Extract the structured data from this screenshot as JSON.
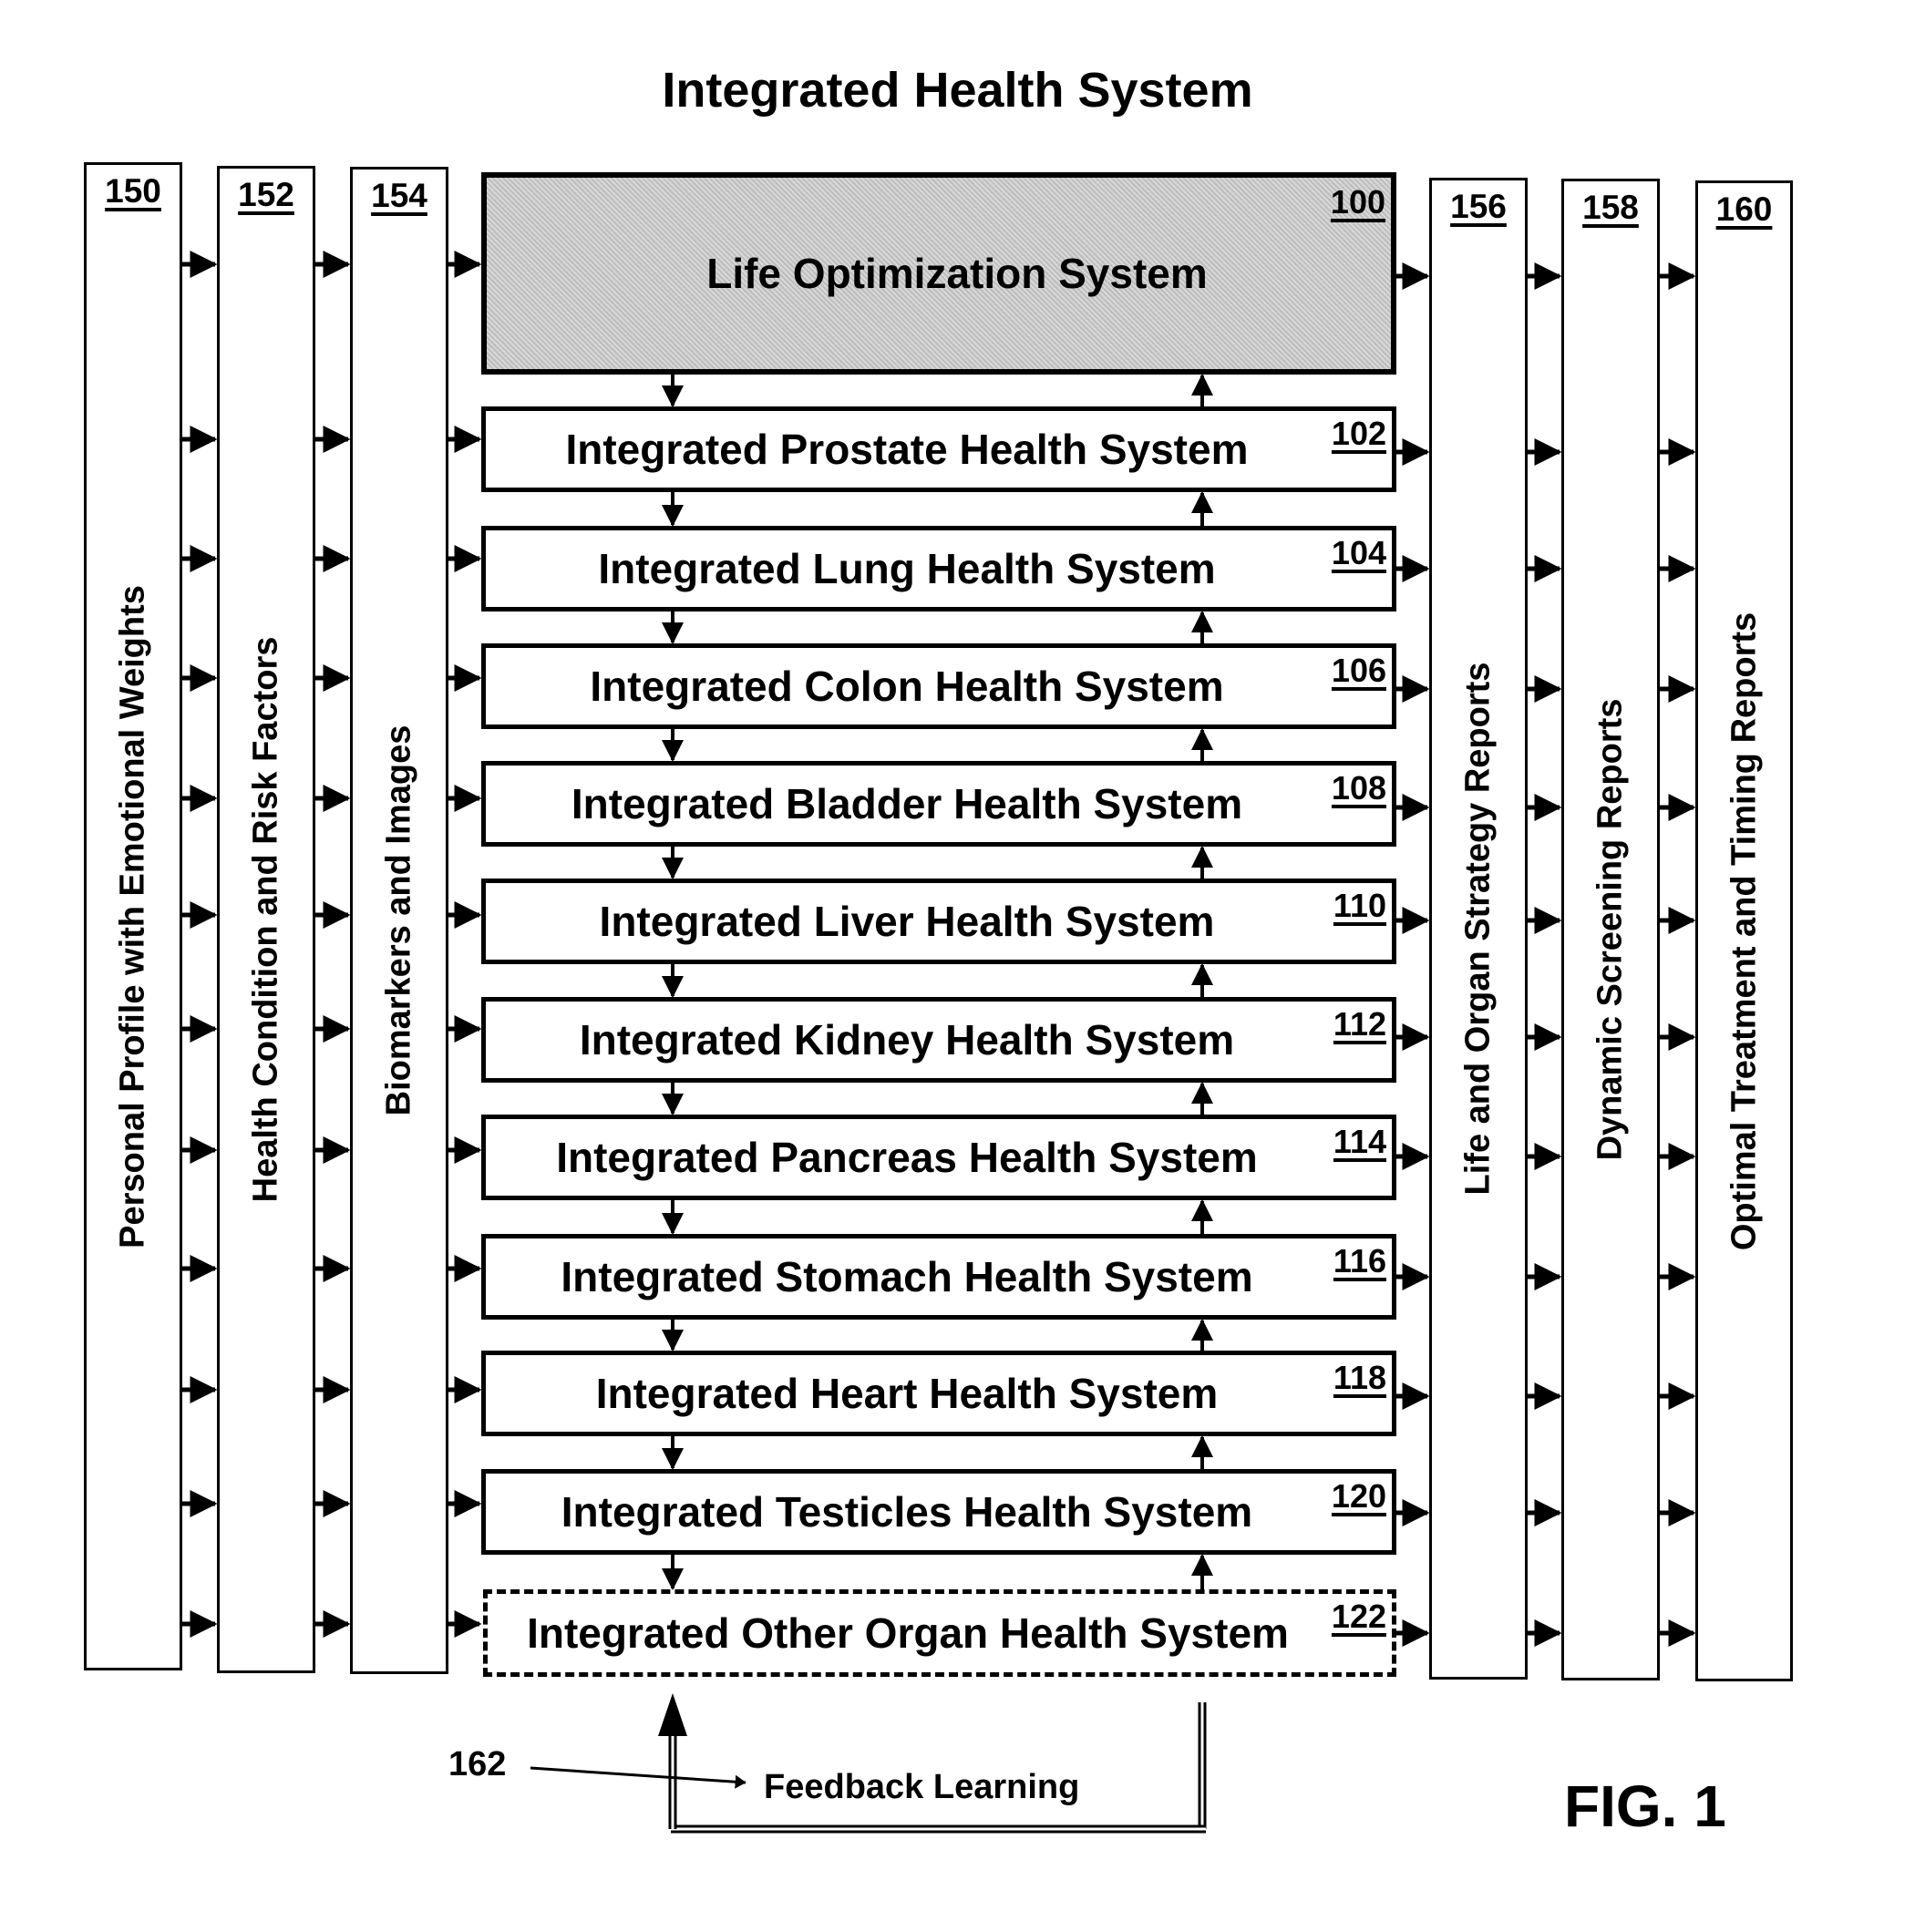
{
  "title": "Integrated Health System",
  "input_columns": [
    {
      "ref": "150",
      "label": "Personal Profile with Emotional Weights"
    },
    {
      "ref": "152",
      "label": "Health Condition and Risk Factors"
    },
    {
      "ref": "154",
      "label": "Biomarkers and Images"
    }
  ],
  "center_boxes": [
    {
      "ref": "100",
      "label": "Life Optimization System",
      "style": "shaded"
    },
    {
      "ref": "102",
      "label": "Integrated Prostate Health System",
      "style": "solid"
    },
    {
      "ref": "104",
      "label": "Integrated Lung Health System",
      "style": "solid"
    },
    {
      "ref": "106",
      "label": "Integrated Colon Health System",
      "style": "solid"
    },
    {
      "ref": "108",
      "label": "Integrated Bladder Health System",
      "style": "solid"
    },
    {
      "ref": "110",
      "label": "Integrated Liver Health System",
      "style": "solid"
    },
    {
      "ref": "112",
      "label": "Integrated Kidney Health System",
      "style": "solid"
    },
    {
      "ref": "114",
      "label": "Integrated Pancreas Health System",
      "style": "solid"
    },
    {
      "ref": "116",
      "label": "Integrated Stomach Health System",
      "style": "solid"
    },
    {
      "ref": "118",
      "label": "Integrated Heart Health System",
      "style": "solid"
    },
    {
      "ref": "120",
      "label": "Integrated Testicles Health System",
      "style": "solid"
    },
    {
      "ref": "122",
      "label": "Integrated Other Organ Health System",
      "style": "dashed"
    }
  ],
  "output_columns": [
    {
      "ref": "156",
      "label": "Life and Organ Strategy Reports"
    },
    {
      "ref": "158",
      "label": "Dynamic Screening Reports"
    },
    {
      "ref": "160",
      "label": "Optimal Treatment and Timing Reports"
    }
  ],
  "feedback": {
    "ref": "162",
    "label": "Feedback Learning"
  },
  "figure_label": "FIG. 1"
}
